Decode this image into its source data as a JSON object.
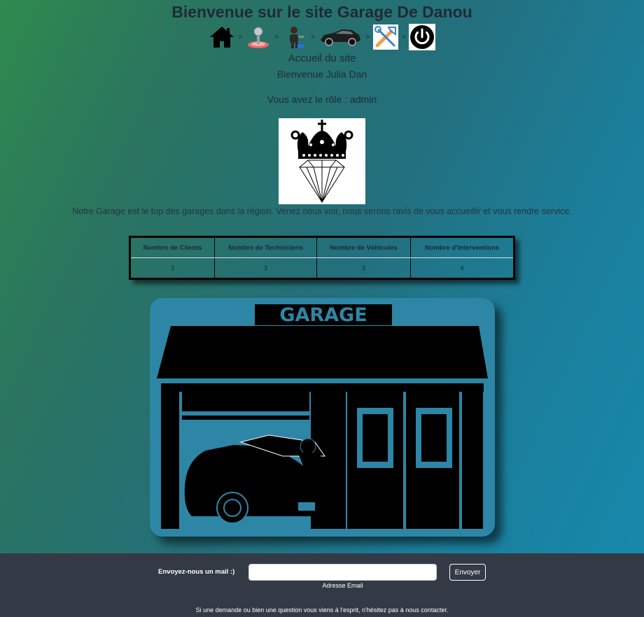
{
  "header": {
    "title": "Bienvenue sur le site Garage De Danou",
    "subtitle": "Accueil du site",
    "welcome": "Bienvenue Julia Dan",
    "role": "Vous avez le rôle : admin"
  },
  "nav": {
    "separator": ">",
    "items": [
      {
        "icon": "home-icon"
      },
      {
        "icon": "joystick-icon"
      },
      {
        "icon": "mechanic-icon"
      },
      {
        "icon": "car-icon"
      },
      {
        "icon": "tools-icon"
      },
      {
        "icon": "power-icon"
      }
    ]
  },
  "intro": "Notre Garage est le top des garages dans la région. Venez nous voir, nous serons ravis de vous accueillir et vous rendre service.",
  "stats": {
    "headers": [
      "Nombre de Clients",
      "Nombre de Techniciens",
      "Nombre de Véhicules",
      "Nombre d'interventions"
    ],
    "values": [
      "3",
      "3",
      "3",
      "4"
    ]
  },
  "garage_image": {
    "sign": "GARAGE"
  },
  "footer": {
    "label": "Envoyez-nous un mail :)",
    "email_value": "",
    "email_placeholder": "",
    "email_caption": "Adresse Email",
    "send_label": "Envoyer",
    "note": "Si une demande ou bien une question vous viens à l'esprit, n'hésitez pas à nous contacter."
  },
  "colors": {
    "footer_bg": "#343a45",
    "card_bg": "#2e86a6"
  }
}
